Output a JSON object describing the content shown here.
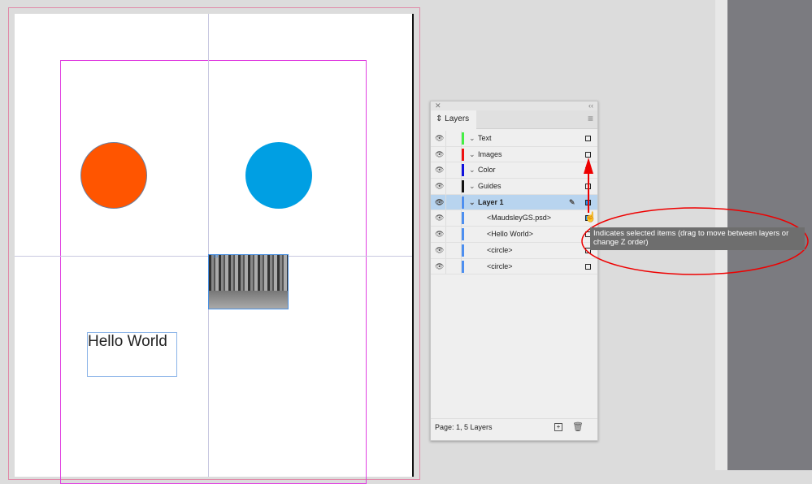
{
  "canvas": {
    "text_frame": "Hello World",
    "colors": {
      "orange": "#ff5500",
      "blue": "#009fe3"
    }
  },
  "panel": {
    "tab": "Layers",
    "close_icon": "close-icon",
    "collapse": "‹‹",
    "menu_icon": "menu-icon",
    "layers": [
      {
        "name": "Text",
        "color": "#44ee44",
        "square": "empty"
      },
      {
        "name": "Images",
        "color": "#ee1111",
        "square": "empty"
      },
      {
        "name": "Color",
        "color": "#1111dd",
        "square": "empty"
      },
      {
        "name": "Guides",
        "color": "#111111",
        "square": "empty"
      },
      {
        "name": "Layer 1",
        "color": "#4d8ff0",
        "selected": true,
        "square": "filled"
      }
    ],
    "sublayers": [
      {
        "name": "<MaudsleyGS.psd>",
        "square": "filled"
      },
      {
        "name": "<Hello World>",
        "square": "empty"
      },
      {
        "name": "<circle>",
        "square": "empty"
      },
      {
        "name": "<circle>",
        "square": "empty"
      }
    ],
    "footer": "Page: 1, 5 Layers"
  },
  "tooltip": "Indicates selected items (drag to move between layers or change Z order)"
}
